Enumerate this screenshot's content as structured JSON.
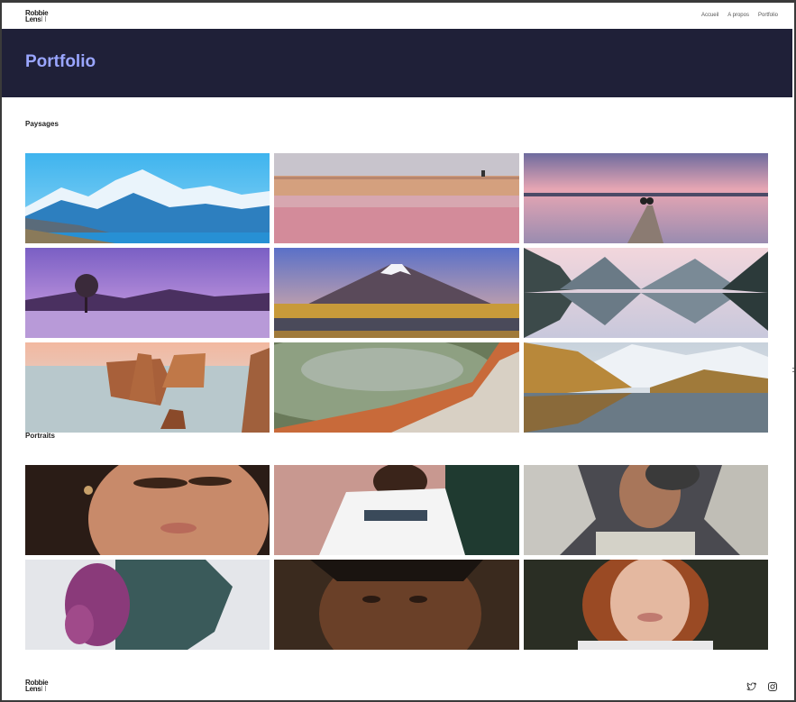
{
  "brand": {
    "line1": "Robbie",
    "line2": "Lens"
  },
  "nav": {
    "items": [
      "Accueil",
      "A propos",
      "Portfolio"
    ]
  },
  "hero": {
    "title": "Portfolio"
  },
  "sections": {
    "landscapes": {
      "title": "Paysages",
      "photos": [
        "mountain-lake-photo",
        "salt-flat-reflection-photo",
        "pier-sunset-photo",
        "lone-tree-lake-photo",
        "volcano-wetland-photo",
        "fjord-reflection-photo",
        "sea-stacks-photo",
        "hot-spring-photo",
        "alpine-valley-photo"
      ]
    },
    "portraits": {
      "title": "Portraits",
      "photos": [
        "portrait-woman-earring-photo",
        "portrait-white-tshirt-photo",
        "portrait-man-hat-photo",
        "portrait-purple-profile-photo",
        "portrait-braids-photo",
        "portrait-redhead-photo"
      ]
    }
  },
  "footer": {
    "brand": {
      "line1": "Robbie",
      "line2": "Lens"
    },
    "social": [
      "twitter-icon",
      "instagram-icon"
    ]
  },
  "colors": {
    "hero_bg": "#1f2038",
    "hero_title": "#9aa6ff"
  }
}
